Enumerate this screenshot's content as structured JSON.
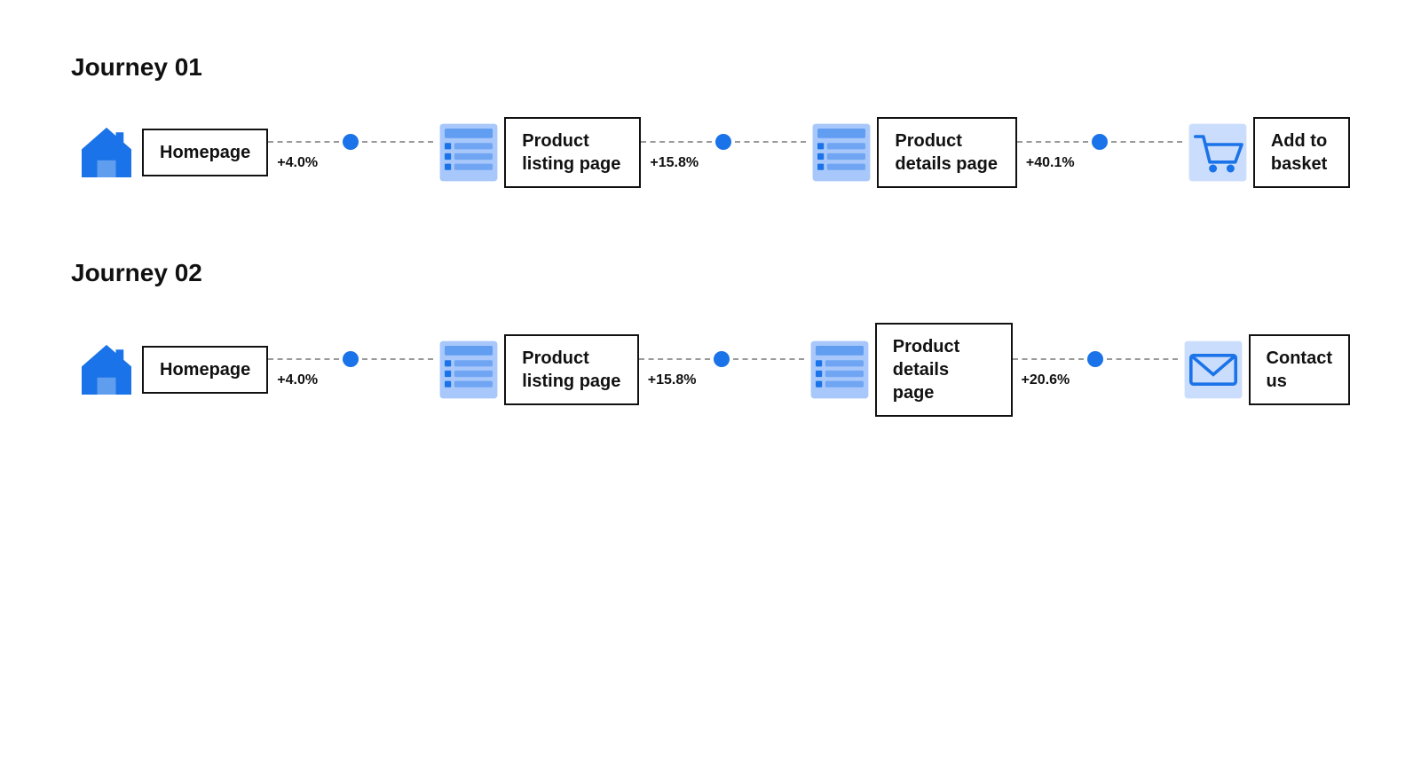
{
  "journeys": [
    {
      "id": "journey-01",
      "title": "Journey 01",
      "steps": [
        {
          "id": "homepage-1",
          "icon": "home",
          "label": "Homepage"
        },
        {
          "id": "listing-1",
          "icon": "listing",
          "label": "Product listing page"
        },
        {
          "id": "details-1",
          "icon": "details",
          "label": "Product details page"
        },
        {
          "id": "basket-1",
          "icon": "basket",
          "label": "Add to basket"
        }
      ],
      "connectors": [
        {
          "pct": "+4.0%"
        },
        {
          "pct": "+15.8%"
        },
        {
          "pct": "+40.1%"
        }
      ]
    },
    {
      "id": "journey-02",
      "title": "Journey 02",
      "steps": [
        {
          "id": "homepage-2",
          "icon": "home",
          "label": "Homepage"
        },
        {
          "id": "listing-2",
          "icon": "listing",
          "label": "Product listing page"
        },
        {
          "id": "details-2",
          "icon": "details",
          "label": "Product details page"
        },
        {
          "id": "contact-2",
          "icon": "contact",
          "label": "Contact us"
        }
      ],
      "connectors": [
        {
          "pct": "+4.0%"
        },
        {
          "pct": "+15.8%"
        },
        {
          "pct": "+20.6%"
        }
      ]
    }
  ]
}
